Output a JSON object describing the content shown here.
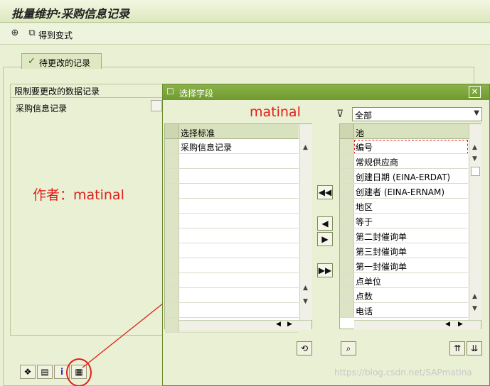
{
  "window": {
    "title": "批量维护:采购信息记录"
  },
  "toolbar": {
    "get_variant_label": "得到变式"
  },
  "tab": {
    "label": "待更改的记录"
  },
  "restrict": {
    "title": "限制要更改的数据记录",
    "row_label": "采购信息记录"
  },
  "annotations": {
    "author": "作者：matinal",
    "dialog_note": "matinal",
    "watermark": "https://blog.csdn.net/SAPmatina"
  },
  "dialog": {
    "title": "选择字段",
    "filter_value": "全部",
    "left_grid": {
      "header": "选择标准",
      "rows": [
        "采购信息记录",
        "",
        "",
        "",
        "",
        "",
        "",
        "",
        "",
        "",
        "",
        "",
        ""
      ]
    },
    "right_grid": {
      "header": "池",
      "rows": [
        "编号",
        "常规供应商",
        "创建日期 (EINA-ERDAT)",
        "创建者 (EINA-ERNAM)",
        "地区",
        "等于",
        "第二封催询单",
        "第三封催询单",
        "第一封催询单",
        "点单位",
        "点数",
        "电话"
      ]
    }
  },
  "colors": {
    "accent": "#6f9a2e",
    "annotation": "#e0201a"
  },
  "icons": [
    "execute-icon",
    "get-variant-icon",
    "move-all-left-icon",
    "move-left-icon",
    "move-right-icon",
    "move-all-right-icon",
    "filter-icon",
    "close-icon"
  ]
}
